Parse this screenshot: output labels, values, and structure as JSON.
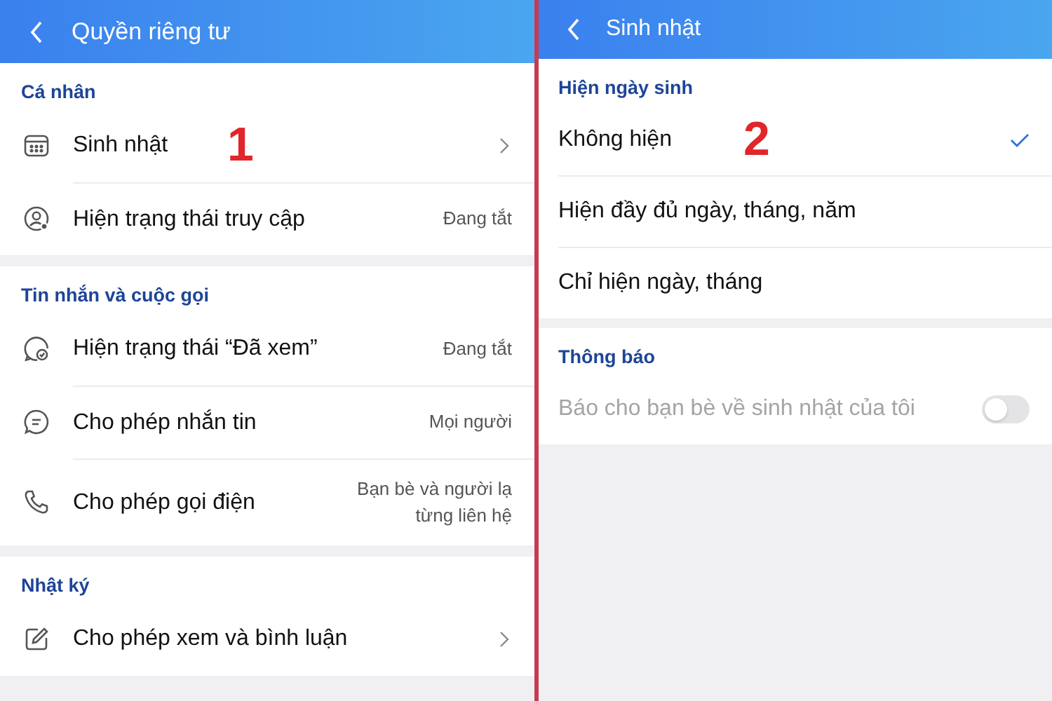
{
  "panels": [
    {
      "title": "Quyền riêng tư",
      "sections": [
        {
          "heading": "Cá nhân",
          "kind": "settings",
          "items": [
            {
              "kind": "calendar",
              "label": "Sinh nhật",
              "annotation": "1"
            },
            {
              "kind": "status",
              "label": "Hiện trạng thái truy cập",
              "value": "Đang tắt"
            }
          ]
        },
        {
          "heading": "Tin nhắn và cuộc gọi",
          "kind": "settings",
          "items": [
            {
              "kind": "seen",
              "label": "Hiện trạng thái “Đã xem”",
              "value": "Đang tắt"
            },
            {
              "kind": "chat",
              "label": "Cho phép nhắn tin",
              "value": "Mọi người"
            },
            {
              "kind": "phone",
              "label": "Cho phép gọi điện",
              "value": "Bạn bè và người lạ từng liên hệ"
            }
          ]
        },
        {
          "heading": "Nhật ký",
          "kind": "settings",
          "items": [
            {
              "kind": "edit",
              "label": "Cho phép xem và bình luận"
            }
          ]
        }
      ]
    },
    {
      "title": "Sinh nhật",
      "sections": [
        {
          "heading": "Hiện ngày sinh",
          "kind": "options",
          "items": [
            {
              "label": "Không hiện",
              "selected": true,
              "annotation": "2"
            },
            {
              "label": "Hiện đầy đủ ngày, tháng, năm",
              "selected": false
            },
            {
              "label": "Chỉ hiện ngày, tháng",
              "selected": false
            }
          ]
        },
        {
          "heading": "Thông báo",
          "kind": "toggles",
          "items": [
            {
              "label": "Báo cho bạn bè về sinh nhật của tôi",
              "on": false,
              "disabled": true
            }
          ]
        }
      ]
    }
  ]
}
